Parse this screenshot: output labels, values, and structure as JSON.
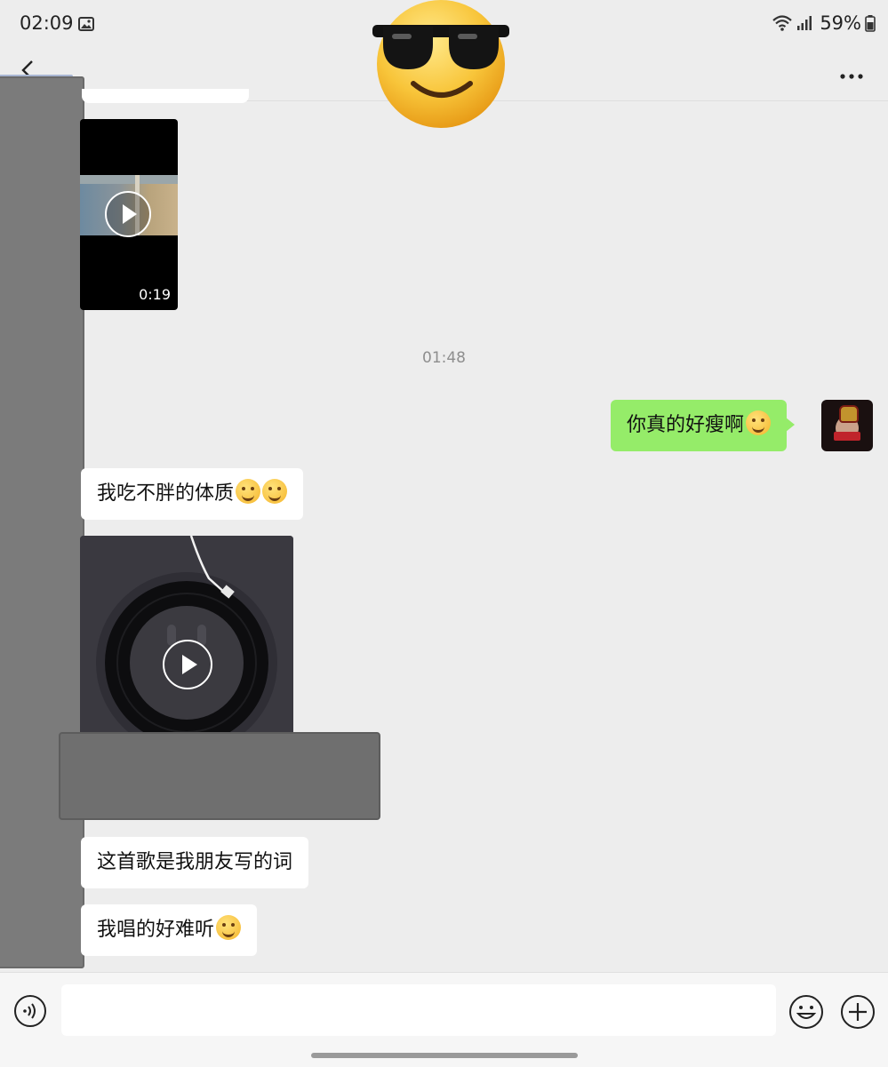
{
  "status_bar": {
    "time": "02:09",
    "battery": "59%",
    "icons": [
      "gallery-icon",
      "wifi-icon",
      "signal-icon",
      "battery-icon"
    ]
  },
  "nav": {
    "back_icon": "chevron-left-icon",
    "more_icon": "more-dots-icon"
  },
  "messages": [
    {
      "type": "video",
      "side": "in",
      "duration": "0:19"
    },
    {
      "type": "timestamp",
      "text": "01:48"
    },
    {
      "type": "text",
      "side": "out",
      "text": "你真的好瘦啊",
      "emojis": [
        "laughing-tears-emoji"
      ]
    },
    {
      "type": "text",
      "side": "in",
      "text": "我吃不胖的体质",
      "emojis": [
        "thinking-giggle-emoji",
        "rolling-laugh-emoji"
      ]
    },
    {
      "type": "music",
      "side": "in"
    },
    {
      "type": "text",
      "side": "in",
      "text": "这首歌是我朋友写的词",
      "emojis": []
    },
    {
      "type": "text",
      "side": "in",
      "text": "我唱的好难听",
      "emojis": [
        "rolling-laugh-emoji"
      ]
    }
  ],
  "input_bar": {
    "value": "",
    "icons": [
      "voice-icon",
      "emoji-icon",
      "plus-icon"
    ]
  },
  "colors": {
    "background": "#ededed",
    "outgoing_bubble": "#95ec69",
    "incoming_bubble": "#ffffff"
  }
}
